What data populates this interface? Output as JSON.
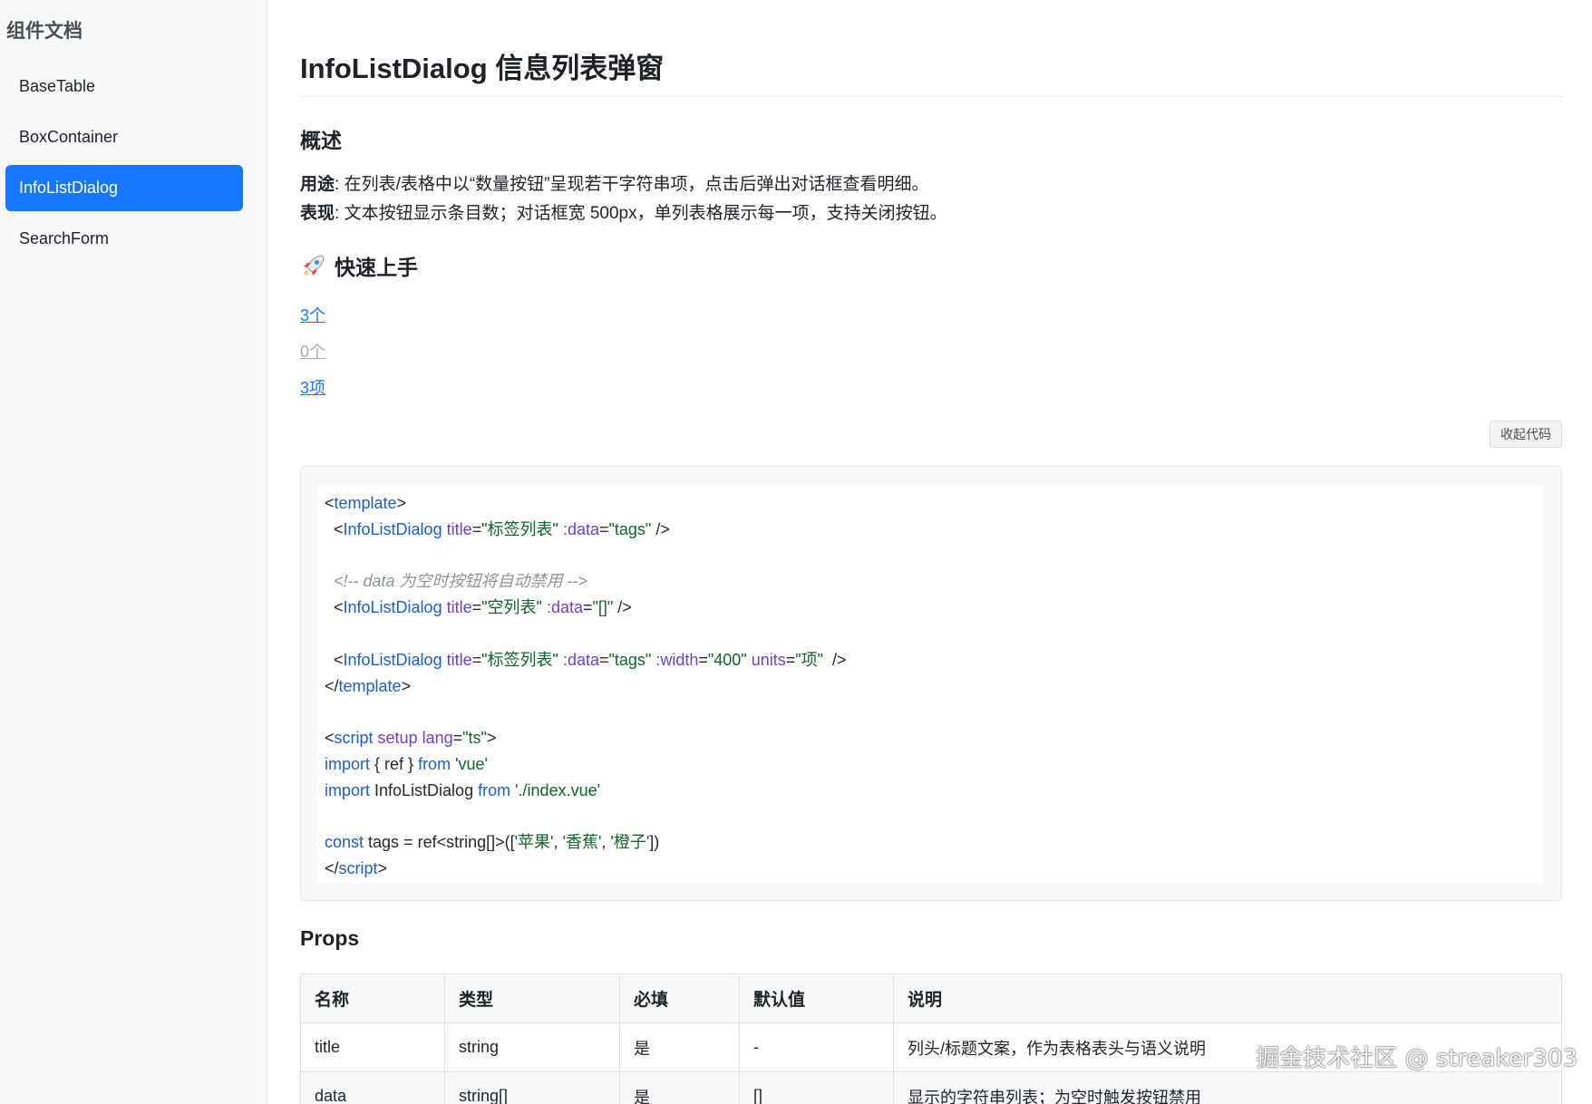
{
  "sidebar": {
    "title": "组件文档",
    "items": [
      {
        "label": "BaseTable",
        "active": false
      },
      {
        "label": "BoxContainer",
        "active": false
      },
      {
        "label": "InfoListDialog",
        "active": true
      },
      {
        "label": "SearchForm",
        "active": false
      }
    ]
  },
  "page": {
    "title": "InfoListDialog 信息列表弹窗",
    "overview_heading": "概述",
    "usage_label": "用途",
    "usage_text": ": 在列表/表格中以“数量按钮”呈现若干字符串项，点击后弹出对话框查看明细。",
    "behavior_label": "表现",
    "behavior_text": ": 文本按钮显示条目数；对话框宽 500px，单列表格展示每一项，支持关闭按钮。",
    "quick_heading": "快速上手",
    "quick_icon": "rocket-icon"
  },
  "demo": {
    "link1": "3个",
    "link2": "0个",
    "link3": "3项",
    "collapse_label": "收起代码"
  },
  "code": {
    "l1_t1": "<",
    "l1_name": "template",
    "l1_t2": ">",
    "l2_t1": "  <",
    "l2_name": "InfoListDialog",
    "l2_sp1": " ",
    "l2_a1": "title",
    "l2_eq1": "=",
    "l2_v1": "\"标签列表\"",
    "l2_sp2": " ",
    "l2_a2": ":data",
    "l2_eq2": "=",
    "l2_v2": "\"tags\"",
    "l2_end": " />",
    "l4_comment": "  <!-- data 为空时按钮将自动禁用 -->",
    "l5_t1": "  <",
    "l5_name": "InfoListDialog",
    "l5_sp1": " ",
    "l5_a1": "title",
    "l5_eq1": "=",
    "l5_v1": "\"空列表\"",
    "l5_sp2": " ",
    "l5_a2": ":data",
    "l5_eq2": "=",
    "l5_v2": "\"[]\"",
    "l5_end": " />",
    "l7_t1": "  <",
    "l7_name": "InfoListDialog",
    "l7_sp1": " ",
    "l7_a1": "title",
    "l7_eq1": "=",
    "l7_v1": "\"标签列表\"",
    "l7_sp2": " ",
    "l7_a2": ":data",
    "l7_eq2": "=",
    "l7_v2": "\"tags\"",
    "l7_sp3": " ",
    "l7_a3": ":width",
    "l7_eq3": "=",
    "l7_v3": "\"400\"",
    "l7_sp4": " ",
    "l7_a4": "units",
    "l7_eq4": "=",
    "l7_v4": "\"项\"",
    "l7_end": "  />",
    "l8_t1": "</",
    "l8_name": "template",
    "l8_t2": ">",
    "l10_t1": "<",
    "l10_name": "script",
    "l10_sp": " ",
    "l10_a1": "setup",
    "l10_sp2": " ",
    "l10_a2": "lang",
    "l10_eq": "=",
    "l10_v": "\"ts\"",
    "l10_t2": ">",
    "l11_kw": "import",
    "l11_mid": " { ref } ",
    "l11_from": "from",
    "l11_sp": " ",
    "l11_str": "'vue'",
    "l12_kw": "import",
    "l12_mid": " InfoListDialog ",
    "l12_from": "from",
    "l12_sp": " ",
    "l12_str": "'./index.vue'",
    "l14_kw": "const",
    "l14_mid": " tags = ref<string[]>([",
    "l14_s1": "'苹果'",
    "l14_c1": ", ",
    "l14_s2": "'香蕉'",
    "l14_c2": ", ",
    "l14_s3": "'橙子'",
    "l14_end": "])",
    "l15_t1": "</",
    "l15_name": "script",
    "l15_t2": ">"
  },
  "props": {
    "heading": "Props",
    "columns": [
      "名称",
      "类型",
      "必填",
      "默认值",
      "说明"
    ],
    "rows": [
      [
        "title",
        "string",
        "是",
        "-",
        "列头/标题文案，作为表格表头与语义说明"
      ],
      [
        "data",
        "string[]",
        "是",
        "[]",
        "显示的字符串列表；为空时触发按钮禁用"
      ]
    ]
  },
  "watermark": "掘金技术社区 @ streaker303",
  "colors": {
    "accent": "#1677ff",
    "disabled": "#a8abb2"
  }
}
